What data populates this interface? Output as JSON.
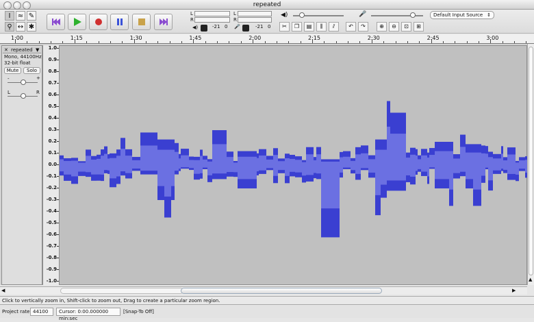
{
  "window": {
    "title": "repeated"
  },
  "toolbar": {
    "tools": [
      {
        "name": "selection-tool",
        "glyph": "I"
      },
      {
        "name": "envelope-tool",
        "glyph": "≈"
      },
      {
        "name": "draw-tool",
        "glyph": "✎"
      },
      {
        "name": "zoom-tool",
        "glyph": "⚲"
      },
      {
        "name": "timeshift-tool",
        "glyph": "↔"
      },
      {
        "name": "multi-tool",
        "glyph": "✱"
      }
    ],
    "meter_output_label": "L",
    "meter_output_label_r": "R",
    "meter_input_label": "L",
    "meter_input_label_r": "R",
    "meter_db_left": "-21",
    "meter_db_left_zero": "0",
    "meter_db_right": "-21",
    "meter_db_right_zero": "0",
    "input_source": "Default Input Source",
    "output_volume": 0.18,
    "input_volume": 0.8
  },
  "ruler": {
    "ticks": [
      "1:00",
      "1:15",
      "1:30",
      "1:45",
      "2:00",
      "2:15",
      "2:30",
      "2:45",
      "3:00"
    ]
  },
  "track": {
    "name": "repeated",
    "info_line1": "Mono, 44100Hz",
    "info_line2": "32-bit float",
    "mute_label": "Mute",
    "solo_label": "Solo",
    "gain_left": "-",
    "gain_right": "+",
    "pan_left": "L",
    "pan_right": "R"
  },
  "vruler": {
    "labels": [
      "1.0",
      "0.9",
      "0.8",
      "0.7",
      "0.6",
      "0.5",
      "0.4",
      "0.3",
      "0.2",
      "0.1",
      "0.0",
      "-0.1",
      "-0.2",
      "-0.3",
      "-0.4",
      "-0.5",
      "-0.6",
      "-0.7",
      "-0.8",
      "-0.9",
      "-1.0"
    ]
  },
  "status": {
    "hint": "Click to vertically zoom in, Shift-click to zoom out, Drag to create a particular zoom region."
  },
  "bottom": {
    "project_rate_label": "Project rate:",
    "project_rate_value": "44100",
    "cursor_text": "Cursor: 0:00.000000 min:sec",
    "snap_text": "[Snap-To Off]"
  },
  "colors": {
    "wave_dark": "#3a3fd1",
    "wave_light": "#6b70e2",
    "wave_bg": "#c0c0c0"
  }
}
